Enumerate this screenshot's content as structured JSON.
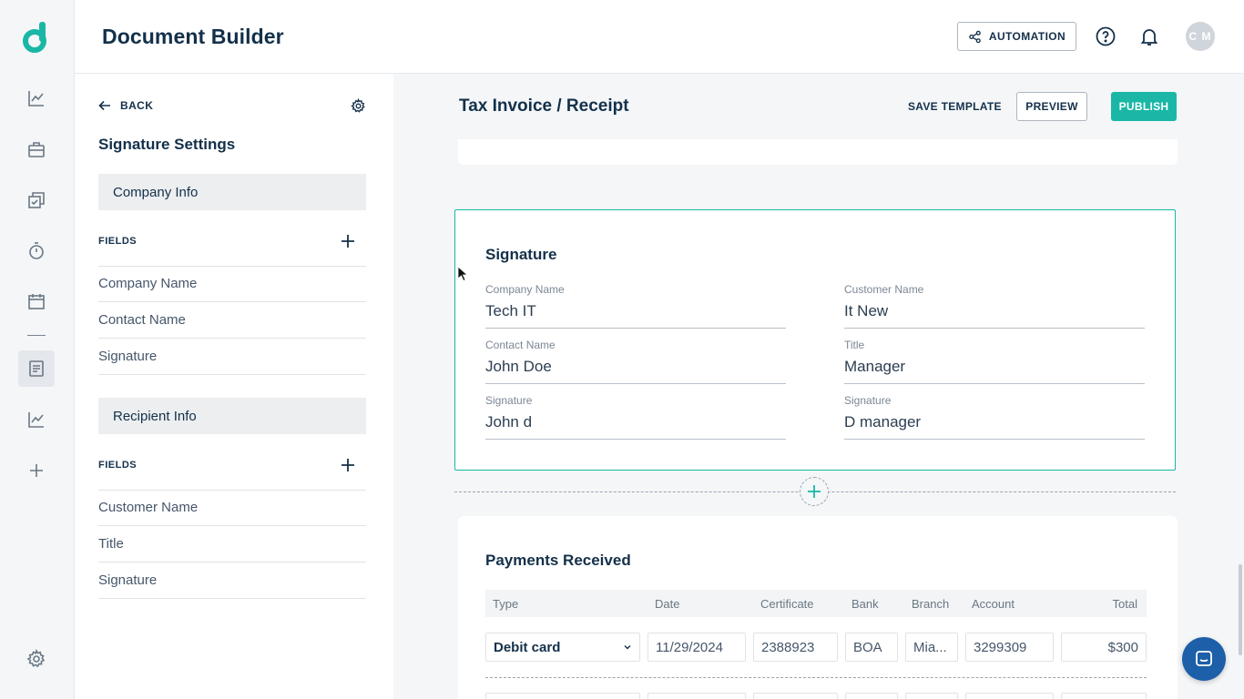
{
  "header": {
    "app_title": "Document Builder",
    "automation_label": "AUTOMATION",
    "avatar_initials": "C M"
  },
  "rail": {
    "icons": [
      "logo-icon",
      "analytics-icon",
      "briefcase-icon",
      "documents-check-icon",
      "stopwatch-icon",
      "calendar-icon",
      "document-builder-icon",
      "reports-icon",
      "add-icon",
      "settings-icon"
    ],
    "active": "document-builder-icon"
  },
  "panel": {
    "back_label": "BACK",
    "title": "Signature Settings",
    "company_section": "Company Info",
    "company_fields_label": "FIELDS",
    "company_fields": [
      "Company Name",
      "Contact Name",
      "Signature"
    ],
    "recipient_section": "Recipient Info",
    "recipient_fields_label": "FIELDS",
    "recipient_fields": [
      "Customer Name",
      "Title",
      "Signature"
    ]
  },
  "main": {
    "doc_title": "Tax Invoice / Receipt",
    "save_template": "SAVE TEMPLATE",
    "preview": "PREVIEW",
    "publish": "PUBLISH"
  },
  "signature": {
    "title": "Signature",
    "left": [
      {
        "label": "Company Name",
        "value": "Tech IT"
      },
      {
        "label": "Contact Name",
        "value": "John Doe"
      },
      {
        "label": "Signature",
        "value": "John d"
      }
    ],
    "right": [
      {
        "label": "Customer Name",
        "value": "It New"
      },
      {
        "label": "Title",
        "value": "Manager"
      },
      {
        "label": "Signature",
        "value": "D manager"
      }
    ]
  },
  "payments": {
    "title": "Payments Received",
    "columns": [
      "Type",
      "Date",
      "Certificate",
      "Bank",
      "Branch",
      "Account",
      "Total"
    ],
    "row": {
      "type": "Debit card",
      "date": "11/29/2024",
      "certificate": "2388923",
      "bank": "BOA",
      "branch": "Mia...",
      "account": "3299309",
      "total": "$300"
    }
  },
  "colors": {
    "accent": "#1ab7a6",
    "brand_dark": "#13304a",
    "chat": "#1d5fa8"
  }
}
